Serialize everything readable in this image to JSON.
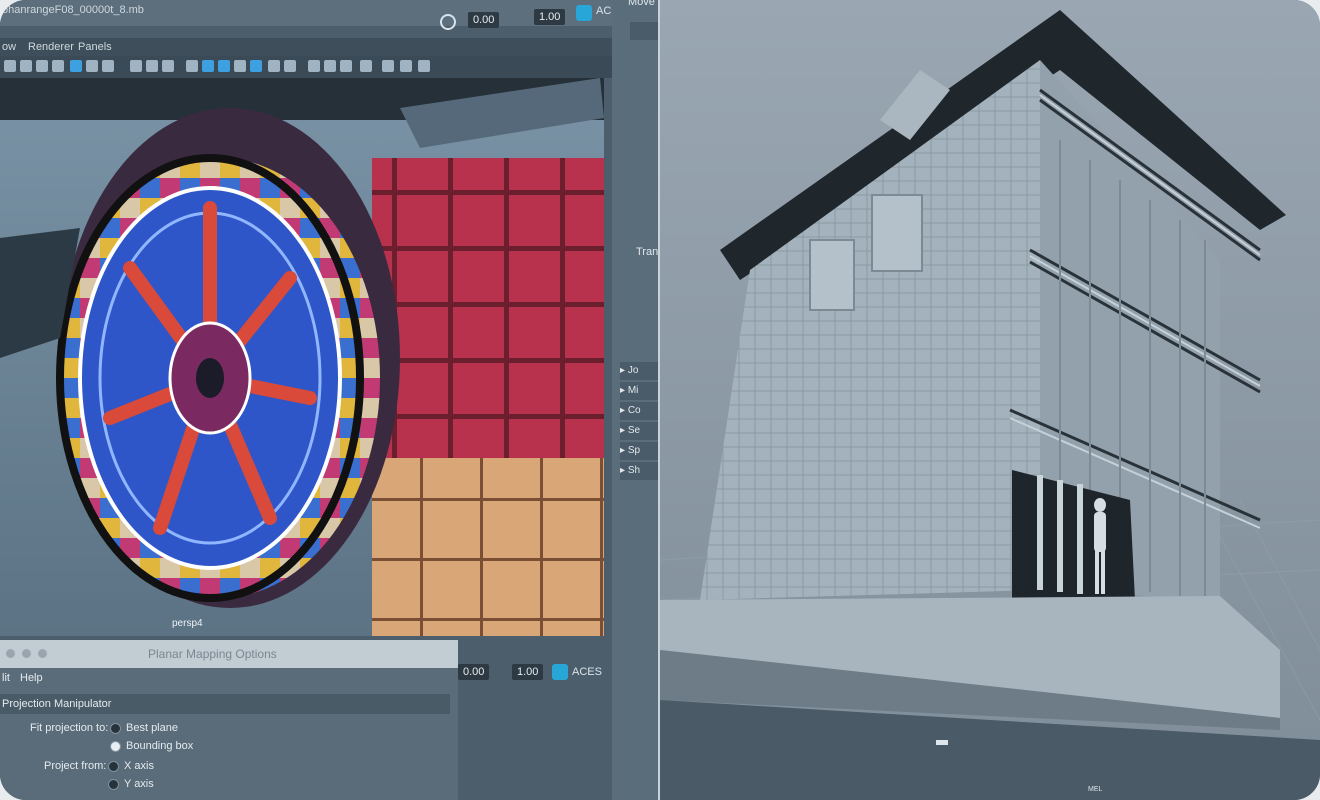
{
  "left_window": {
    "title_fragment": "ohanrangeF08_00000t_8.mb",
    "menus": [
      "ow",
      "Renderer",
      "Panels"
    ],
    "toolbar": {
      "value_a": "0.00",
      "value_b": "1.00",
      "colorspace": "ACES"
    },
    "side_panel": {
      "tool_label": "Move",
      "transform_label": "Tran",
      "sections": [
        "Jo",
        "Mi",
        "Co",
        "Se",
        "Sp",
        "Sh"
      ]
    },
    "viewport": {
      "camera_label": "persp4"
    },
    "secondary_toolbar": {
      "value_a": "0.00",
      "value_b": "1.00",
      "colorspace": "ACES"
    }
  },
  "dialog": {
    "title": "Planar Mapping Options",
    "menus": [
      "lit",
      "Help"
    ],
    "section": "Projection Manipulator",
    "fit_label": "Fit projection to:",
    "fit_options": [
      "Best plane",
      "Bounding box"
    ],
    "fit_selected": "Bounding box",
    "project_label": "Project from:",
    "project_options": [
      "X axis",
      "Y axis"
    ]
  },
  "right_pane": {
    "footer_small_text": "MEL"
  },
  "colors": {
    "accent_blue": "#29a6d8",
    "viewport_bg": "#5f7585",
    "panel_bg": "#5a6d7b"
  }
}
